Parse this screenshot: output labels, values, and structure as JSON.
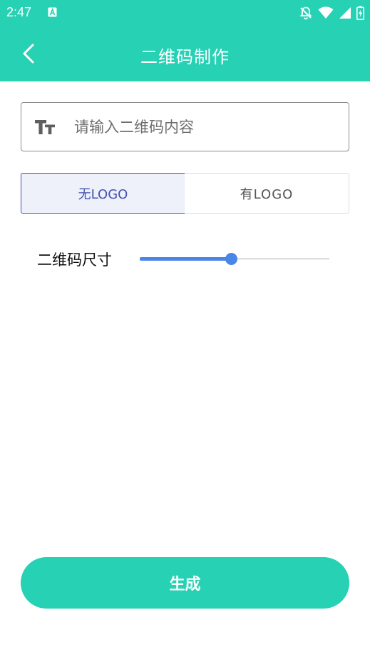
{
  "status_bar": {
    "time": "2:47",
    "icons": [
      "notification-a-icon",
      "bell-off-icon",
      "wifi-icon",
      "signal-icon",
      "battery-charging-icon"
    ]
  },
  "app_bar": {
    "title": "二维码制作",
    "color": "#26d1b4"
  },
  "content_input": {
    "placeholder": "请输入二维码内容",
    "value": ""
  },
  "logo_toggle": {
    "options": [
      "无LOGO",
      "有LOGO"
    ],
    "selected": "无LOGO"
  },
  "size": {
    "label": "二维码尺寸",
    "slider_value": 0.48
  },
  "generate_label": "生成"
}
